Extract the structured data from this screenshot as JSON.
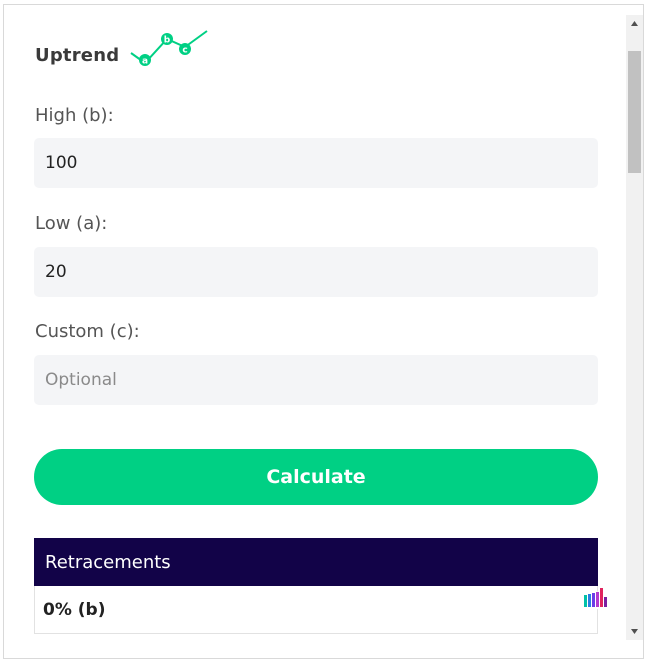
{
  "trend": {
    "label": "Uptrend",
    "icon": "abc-uptrend-icon",
    "points": [
      "a",
      "b",
      "c"
    ]
  },
  "fields": {
    "high": {
      "label": "High (b):",
      "value": "100"
    },
    "low": {
      "label": "Low (a):",
      "value": "20"
    },
    "custom": {
      "label": "Custom (c):",
      "placeholder": "Optional",
      "value": ""
    }
  },
  "calculate_label": "Calculate",
  "table": {
    "header": "Retracements",
    "rows": [
      {
        "label": "0% (b)"
      }
    ]
  },
  "colors": {
    "accent": "#00d084",
    "table_header": "#120348",
    "input_bg": "#f4f5f7"
  }
}
